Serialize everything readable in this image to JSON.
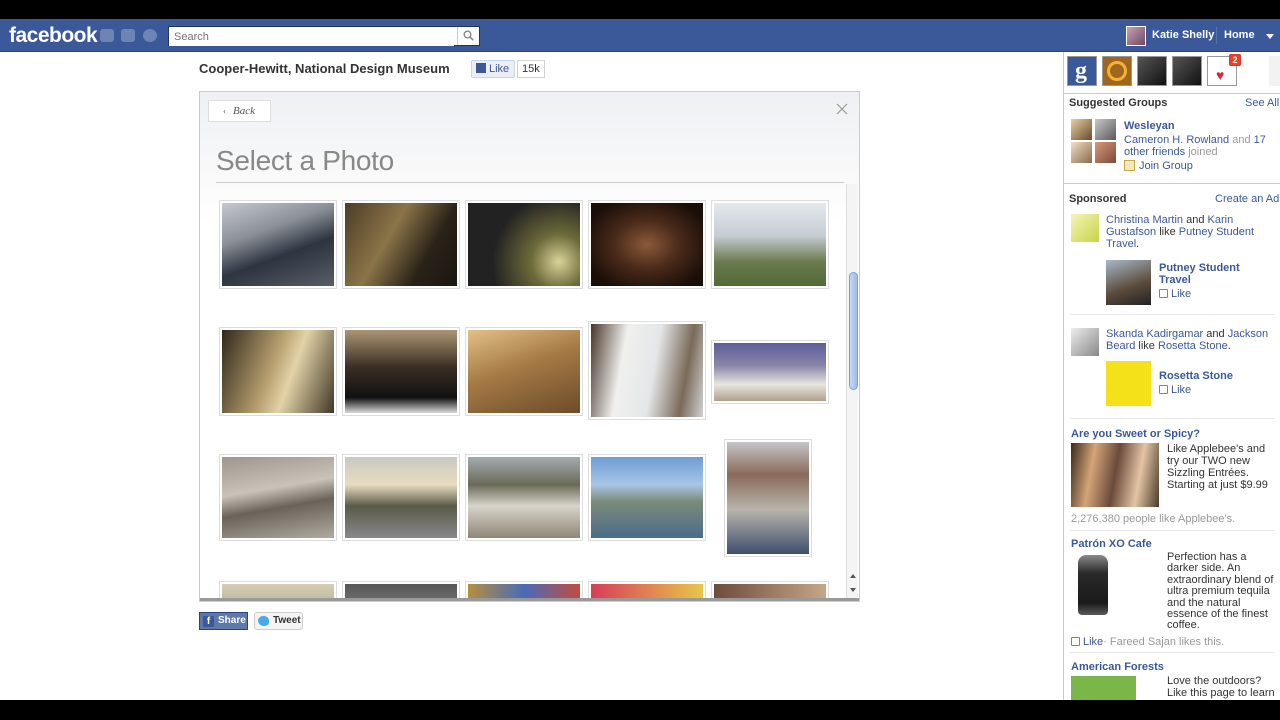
{
  "topbar": {
    "logo": "facebook",
    "search_placeholder": "Search",
    "user_name": "Katie Shelly",
    "home_label": "Home"
  },
  "page": {
    "title": "Cooper-Hewitt, National Design Museum",
    "like_label": "Like",
    "like_count": "15k"
  },
  "panel": {
    "back_label": "Back",
    "title": "Select a Photo"
  },
  "share": {
    "share_label": "Share",
    "tweet_label": "Tweet"
  },
  "sidebar": {
    "notification_count": "2",
    "suggested_groups": {
      "heading": "Suggested Groups",
      "see_all": "See All",
      "group_name": "Wesleyan",
      "members": "Cameron H. Rowland",
      "and": "and",
      "others": "17 other friends",
      "joined": "joined",
      "join_label": "Join Group"
    },
    "sponsored": {
      "heading": "Sponsored",
      "create_ad": "Create an Ad"
    },
    "ads": [
      {
        "friend1": "Christina Martin",
        "and": "and",
        "friend2": "Karin Gustafson",
        "like": "like",
        "page": "Putney Student Travel",
        "page_name": "Putney Student Travel",
        "like_label": "Like"
      },
      {
        "friend1": "Skanda Kadirgamar",
        "and": "and",
        "friend2": "Jackson Beard",
        "like": "like",
        "page": "Rosetta Stone",
        "page_name": "Rosetta Stone",
        "like_label": "Like"
      }
    ],
    "applebees": {
      "title": "Are you Sweet or Spicy?",
      "body": "Like Applebee's and try our TWO new Sizzling Entrées. Starting at just $9.99",
      "likes": "2,276,380 people like Applebee's."
    },
    "patron": {
      "title": "Patrón XO Cafe",
      "body": "Perfection has a darker side. An extraordinary blend of ultra premium tequila and the natural essence of the finest coffee.",
      "like_label": "Like",
      "social": "· Fareed Sajan likes this."
    },
    "forests": {
      "title": "American Forests",
      "body": "Love the outdoors? Like this page to learn"
    }
  },
  "colors": {
    "fb_blue": "#3b5998",
    "link": "#3b5998"
  }
}
